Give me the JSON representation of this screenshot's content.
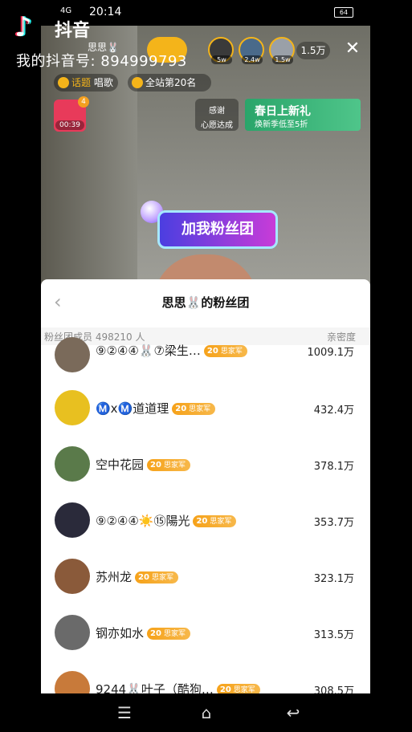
{
  "status": {
    "signal": "4G",
    "time": "20:14",
    "battery": "64"
  },
  "watermark": {
    "logo": "♪",
    "name": "抖音",
    "id": "我的抖音号: 894999793"
  },
  "live": {
    "host_name": "思思🐰",
    "viewers": [
      {
        "badge": "5w",
        "color": "#3a3a3a"
      },
      {
        "badge": "2.4w",
        "color": "#4a6a8a"
      },
      {
        "badge": "1.5w",
        "color": "#9aa0a8"
      }
    ],
    "viewer_count": "1.5万",
    "tags": [
      {
        "icon": "topic",
        "highlight": "话题",
        "text": "唱歌"
      },
      {
        "icon": "rank",
        "highlight": "",
        "text": "全站第20名"
      }
    ],
    "redpacket": {
      "count": "4",
      "timer": "00:39"
    },
    "wish": {
      "line1": "感谢",
      "line2": "心愿达成"
    },
    "promo": {
      "title": "春日上新礼",
      "subtitle": "焕新季低至5折"
    },
    "fan_bubble": "加我粉丝团"
  },
  "panel": {
    "title": "思思🐰的粉丝团",
    "members_label": "粉丝团成员 498210 人",
    "intimacy_label": "亲密度",
    "badge_level": "20",
    "badge_name": "思家军",
    "rows": [
      {
        "name": "⑨②④④🐰⑦梁生…",
        "score": "1009.1万",
        "avatar": "#7a6a5a"
      },
      {
        "name": "Ⓜ️xⓂ️道道理",
        "score": "432.4万",
        "avatar": "#e8c020"
      },
      {
        "name": "空中花园",
        "score": "378.1万",
        "avatar": "#5a7a4a"
      },
      {
        "name": "⑨②④④☀️⑮陽光",
        "score": "353.7万",
        "avatar": "#2a2a3a"
      },
      {
        "name": "苏州龙",
        "score": "323.1万",
        "avatar": "#8a5a3a"
      },
      {
        "name": "钢亦如水",
        "score": "313.5万",
        "avatar": "#6a6a6a"
      },
      {
        "name": "9244🐰叶子（酷狗…",
        "score": "308.5万",
        "avatar": "#c87a3a"
      }
    ]
  },
  "nav": {
    "menu": "☰",
    "home": "⌂",
    "back": "↩"
  }
}
